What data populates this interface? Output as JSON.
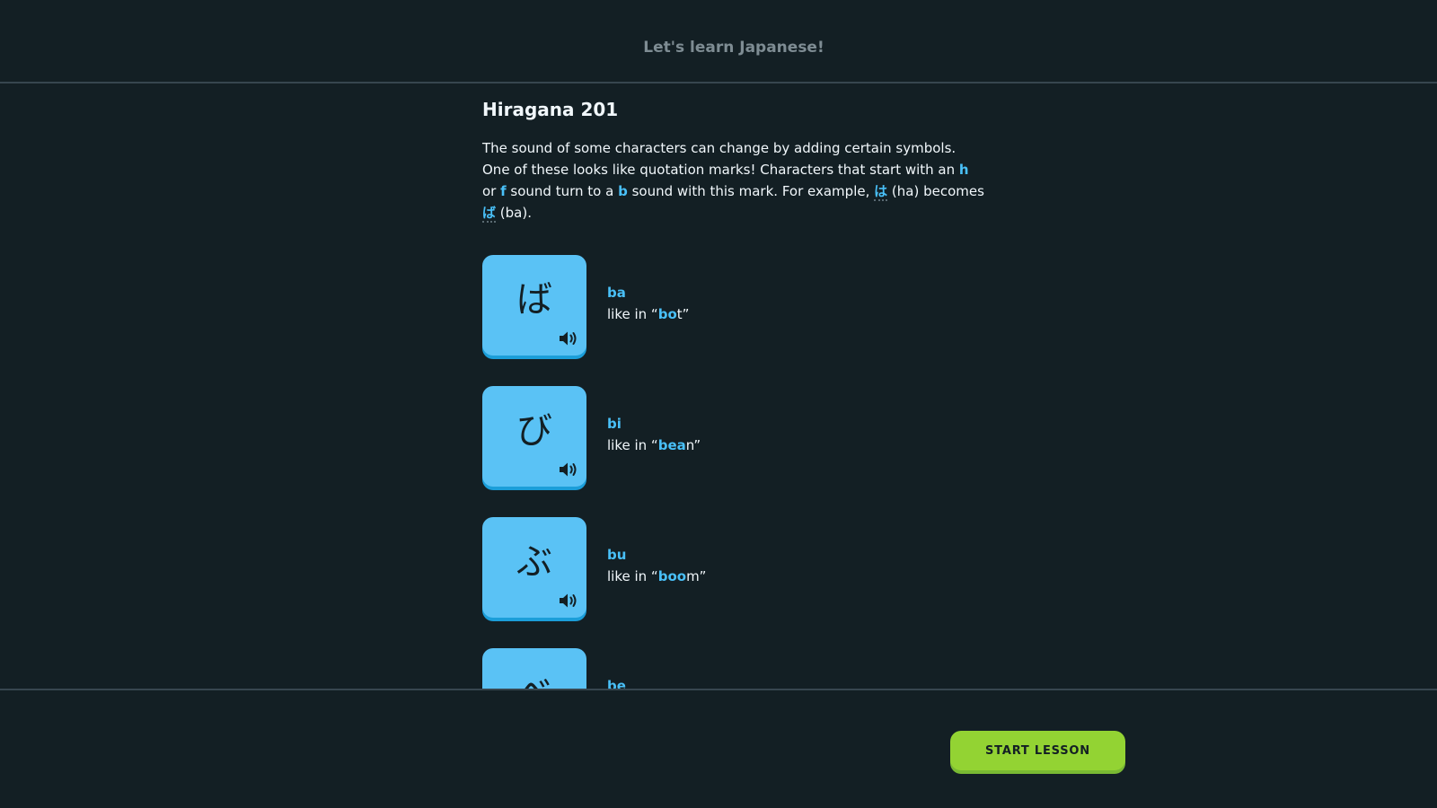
{
  "header": {
    "title": "Let's learn Japanese!"
  },
  "lesson": {
    "title": "Hiragana 201",
    "intro": {
      "t1": "The sound of some characters can change by adding certain symbols. One of these looks like quotation marks! Characters that start with an ",
      "h": "h",
      "t2": " or ",
      "f": "f",
      "t3": " sound turn to a ",
      "b": "b",
      "t4": " sound with this mark. For example, ",
      "kana_ha": "は",
      "t5": " (ha) becomes ",
      "kana_ba": "ば",
      "t6": " (ba)."
    }
  },
  "characters": [
    {
      "kana": "ば",
      "romaji": "ba",
      "example_prefix": "like in “",
      "example_highlight": "bo",
      "example_rest": "t”"
    },
    {
      "kana": "び",
      "romaji": "bi",
      "example_prefix": "like in “",
      "example_highlight": "bea",
      "example_rest": "n”"
    },
    {
      "kana": "ぶ",
      "romaji": "bu",
      "example_prefix": "like in “",
      "example_highlight": "boo",
      "example_rest": "m”"
    },
    {
      "kana": "べ",
      "romaji": "be"
    }
  ],
  "icons": {
    "speaker": "speaker-icon"
  },
  "colors": {
    "background": "#131f24",
    "card": "#5ac2f5",
    "highlight": "#49c0f8",
    "primary_button": "#93d333"
  },
  "footer": {
    "start_label": "START LESSON"
  }
}
